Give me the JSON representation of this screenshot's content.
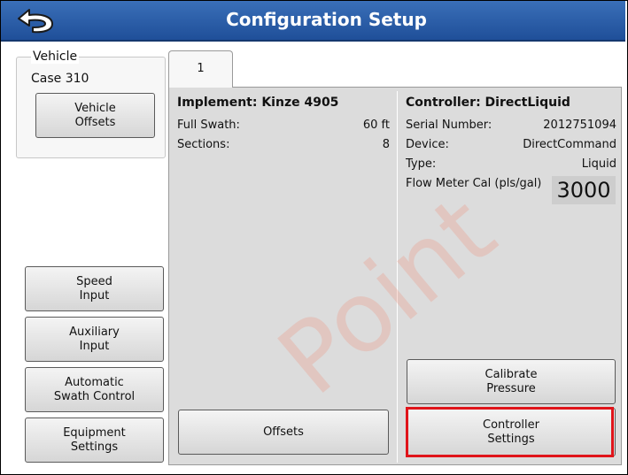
{
  "header": {
    "title": "Configuration Setup",
    "back_icon": "back-arrow-icon"
  },
  "vehicle": {
    "legend": "Vehicle",
    "name": "Case 310",
    "offsets_button": "Vehicle\nOffsets"
  },
  "left_buttons": [
    {
      "label": "Speed\nInput"
    },
    {
      "label": "Auxiliary\nInput"
    },
    {
      "label": "Automatic\nSwath Control"
    },
    {
      "label": "Equipment\nSettings"
    }
  ],
  "tabs": [
    {
      "label": "1"
    }
  ],
  "implement": {
    "title": "Implement: Kinze 4905",
    "rows": [
      {
        "label": "Full Swath:",
        "value": "60 ft"
      },
      {
        "label": "Sections:",
        "value": "8"
      }
    ],
    "offsets_button": "Offsets"
  },
  "controller": {
    "title": "Controller: DirectLiquid",
    "rows": [
      {
        "label": "Serial Number:",
        "value": "2012751094"
      },
      {
        "label": "Device:",
        "value": "DirectCommand"
      },
      {
        "label": "Type:",
        "value": "Liquid"
      }
    ],
    "flow_label": "Flow Meter Cal (pls/gal)",
    "flow_value": "3000",
    "calibrate_button": "Calibrate\nPressure",
    "settings_button": "Controller\nSettings"
  },
  "watermark": "Point",
  "colors": {
    "titlebar": "#2a5ea8",
    "highlight": "#e0141a"
  }
}
